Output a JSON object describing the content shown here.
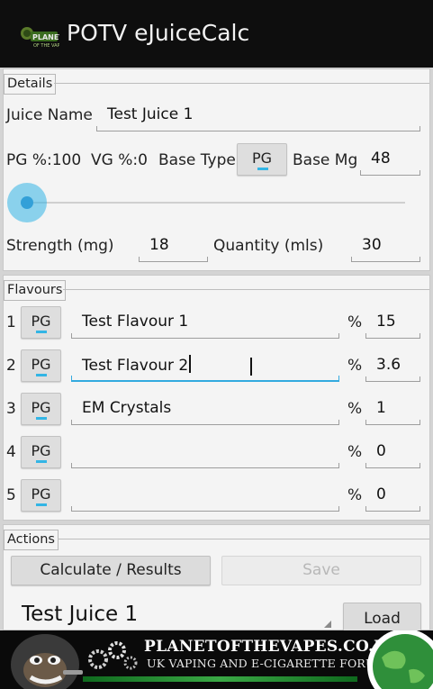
{
  "app": {
    "title": "POTV eJuiceCalc",
    "logo_icon": "potv-logo-icon"
  },
  "details": {
    "section_label": "Details",
    "juice_name_label": "Juice Name",
    "juice_name_value": "Test Juice 1",
    "pg_percent_label": "PG %:100",
    "vg_percent_label": "VG %:0",
    "base_type_label": "Base Type",
    "base_type_value": "PG",
    "base_mg_label": "Base Mg",
    "base_mg_value": "48",
    "pg_vg_slider_fraction": 0.0,
    "strength_label": "Strength (mg)",
    "strength_value": "18",
    "quantity_label": "Quantity (mls)",
    "quantity_value": "30"
  },
  "flavours": {
    "section_label": "Flavours",
    "percent_symbol": "%",
    "items": [
      {
        "index": "1",
        "base": "PG",
        "name": "Test Flavour 1",
        "percent": "15"
      },
      {
        "index": "2",
        "base": "PG",
        "name": "Test Flavour 2",
        "percent": "3.6"
      },
      {
        "index": "3",
        "base": "PG",
        "name": "EM Crystals",
        "percent": "1"
      },
      {
        "index": "4",
        "base": "PG",
        "name": "",
        "percent": "0"
      },
      {
        "index": "5",
        "base": "PG",
        "name": "",
        "percent": "0"
      }
    ]
  },
  "actions": {
    "section_label": "Actions",
    "calculate_label": "Calculate / Results",
    "save_label": "Save",
    "saved_juice_value": "Test Juice 1",
    "load_label": "Load"
  },
  "banner": {
    "title": "PLANETOFTHEVAPES.CO.UK",
    "subtitle": "UK VAPING AND E-CIGARETTE FORUM",
    "icons": [
      "gorilla-icon",
      "gears-icon",
      "globe-icon"
    ]
  },
  "colors": {
    "accent": "#33b5e5",
    "action_bar": "#0e0e0e",
    "panel": "#f4f4f4",
    "background": "#d4d4d4"
  }
}
